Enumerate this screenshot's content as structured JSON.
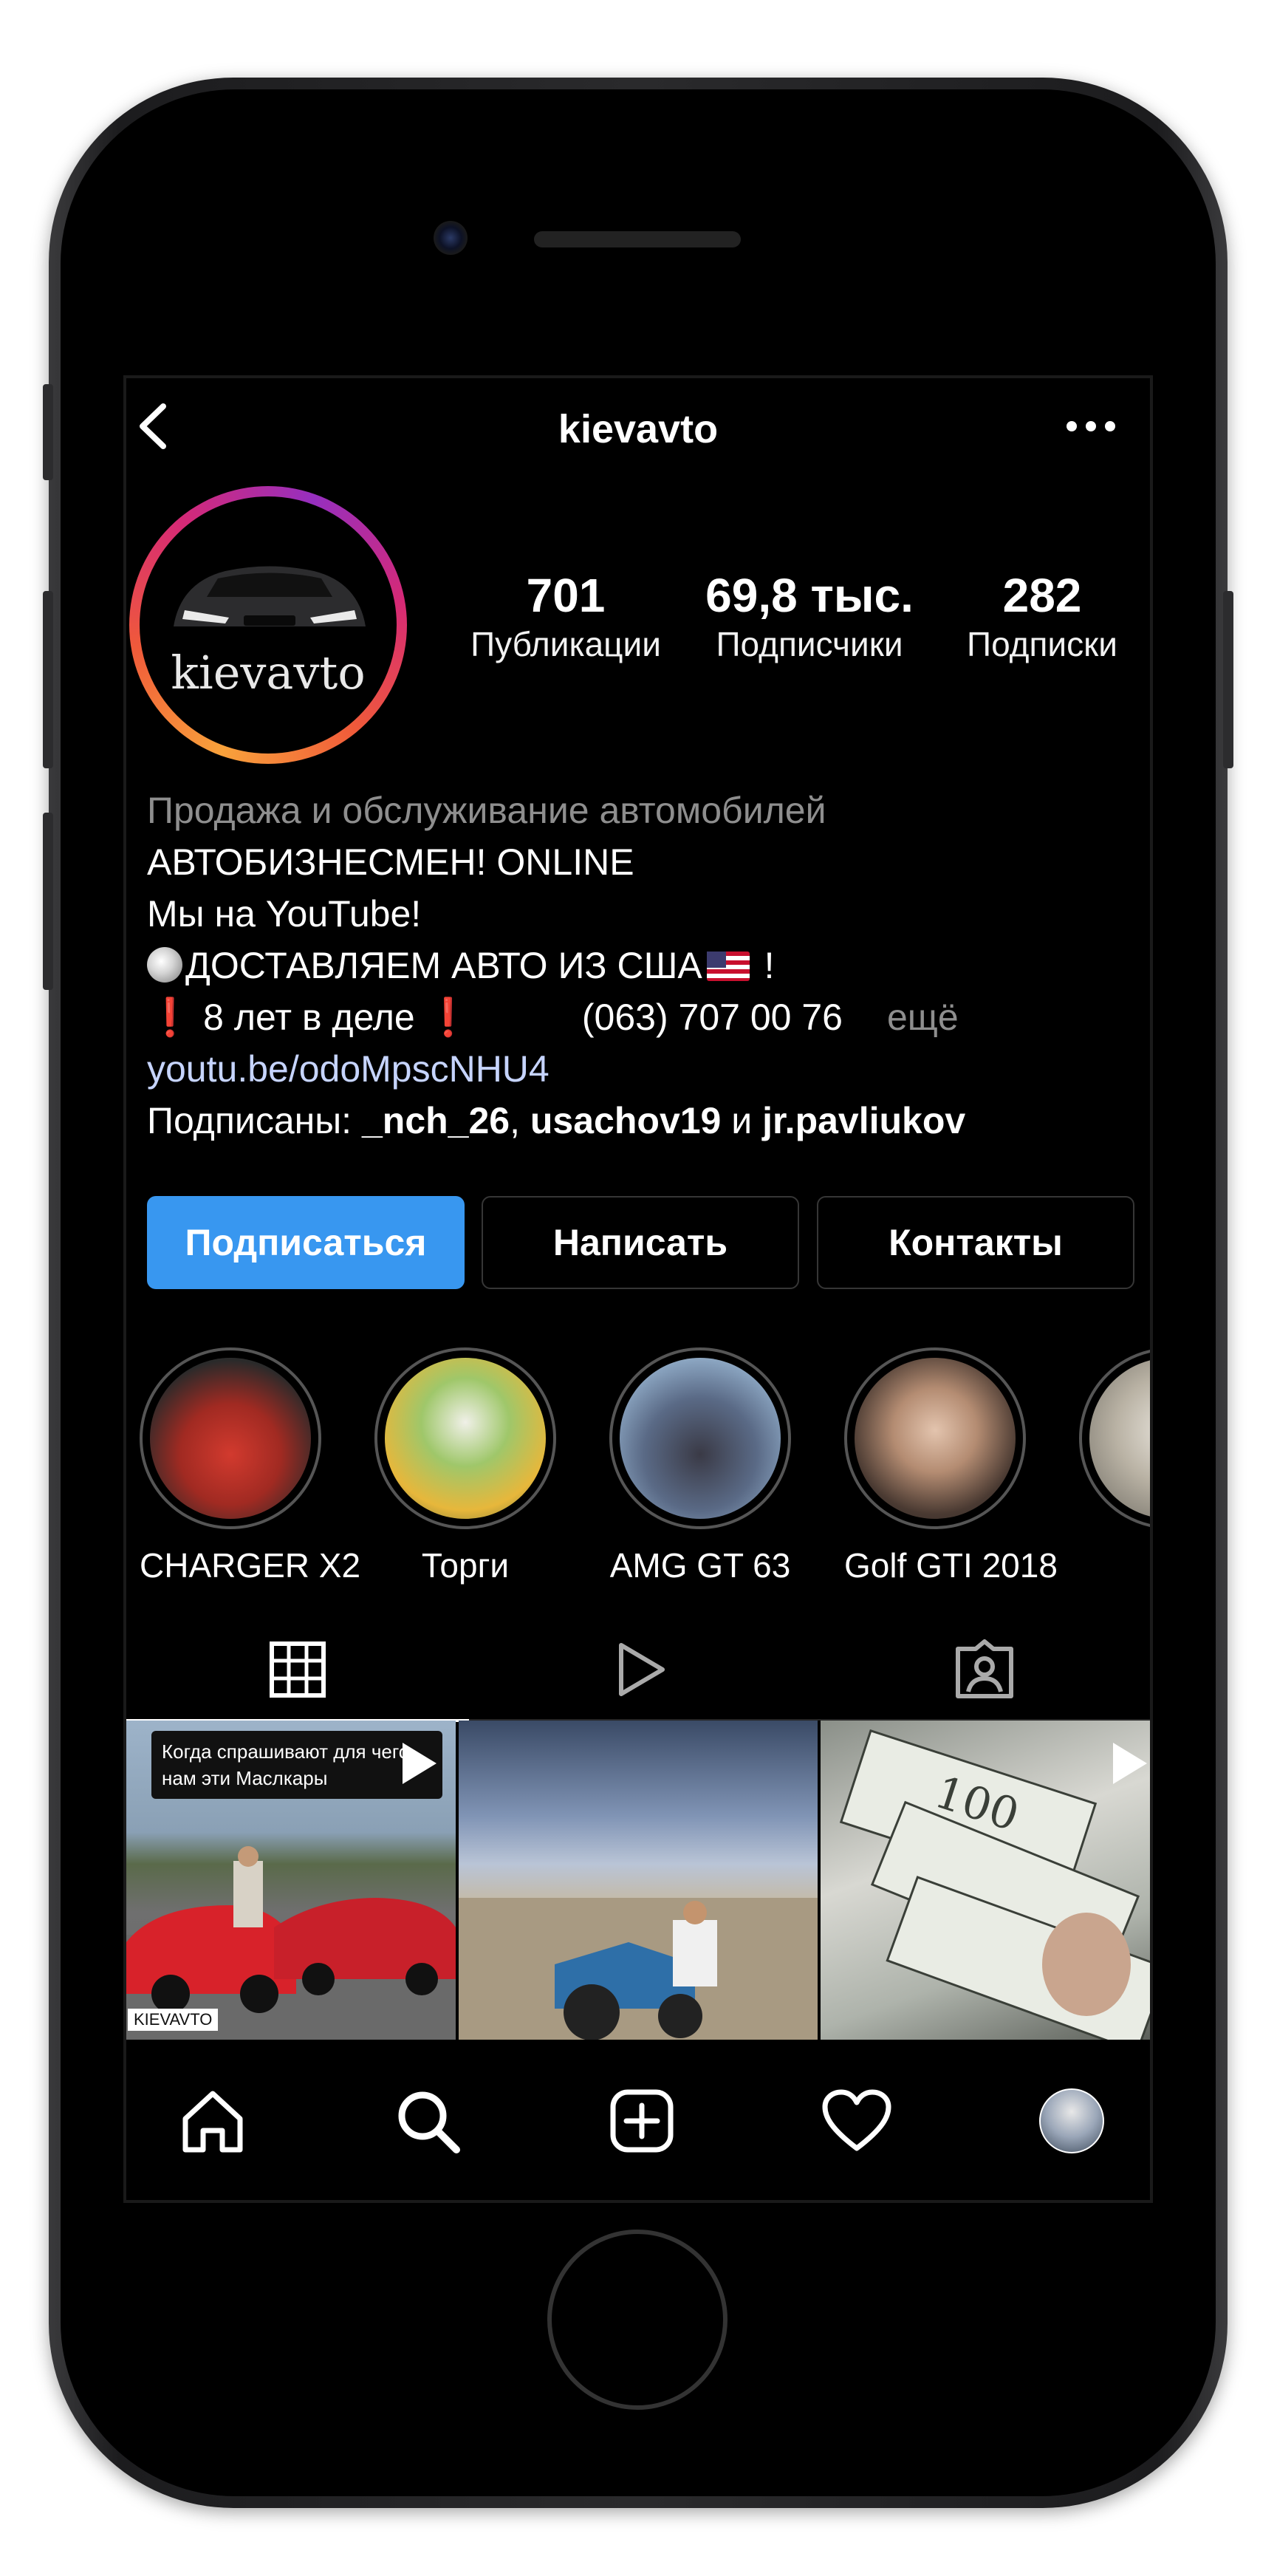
{
  "profile": {
    "username": "kievavto",
    "avatar_text": "kievavto",
    "stats": [
      {
        "value": "701",
        "label": "Публикации"
      },
      {
        "value": "69,8 тыс.",
        "label": "Подписчики"
      },
      {
        "value": "282",
        "label": "Подписки"
      }
    ],
    "bio": {
      "category": "Продажа и обслуживание автомобилей",
      "line1": "АВТОБИЗНЕСМЕН! ONLINE",
      "line2": "Мы на YouTube!",
      "line3": "ДОСТАВЛЯЕМ АВТО ИЗ США",
      "line3_end": " !",
      "line4_mark": "❗",
      "line4": " 8 лет в деле ",
      "line4_phone": "(063) 707 00 76",
      "more": "ещё",
      "link": "youtu.be/odoMpscNHU4",
      "followed_prefix": "Подписаны: ",
      "followed_1": "_nch_26",
      "followed_sep": ", ",
      "followed_2": "usachov19",
      "followed_and": " и ",
      "followed_3": "jr.pavliukov"
    }
  },
  "actions": {
    "follow": "Подписаться",
    "message": "Написать",
    "contacts": "Контакты"
  },
  "highlights": [
    {
      "label": "CHARGER X2",
      "color": "#c0302a"
    },
    {
      "label": "Торги",
      "color": "#8fbf4a"
    },
    {
      "label": "AMG GT 63",
      "color": "#3a4a6a"
    },
    {
      "label": "Golf GTI 2018",
      "color": "#6a5446"
    },
    {
      "label": "",
      "color": "#b9b2a4"
    }
  ],
  "tabs": [
    {
      "name": "grid-icon",
      "active": true
    },
    {
      "name": "reels-icon",
      "active": false
    },
    {
      "name": "tagged-icon",
      "active": false
    }
  ],
  "posts": [
    {
      "caption": "Когда спрашивают для чего нам эти Маслкары",
      "plate": "KIEVAVTO",
      "video": true
    },
    {
      "caption": "",
      "video": false
    },
    {
      "caption": "",
      "video": true
    }
  ],
  "bottom_nav": [
    "home-icon",
    "search-icon",
    "add-post-icon",
    "heart-icon",
    "profile-avatar"
  ],
  "colors": {
    "accent": "#3897f0",
    "story_ring": "#d62976",
    "background": "#000000"
  }
}
